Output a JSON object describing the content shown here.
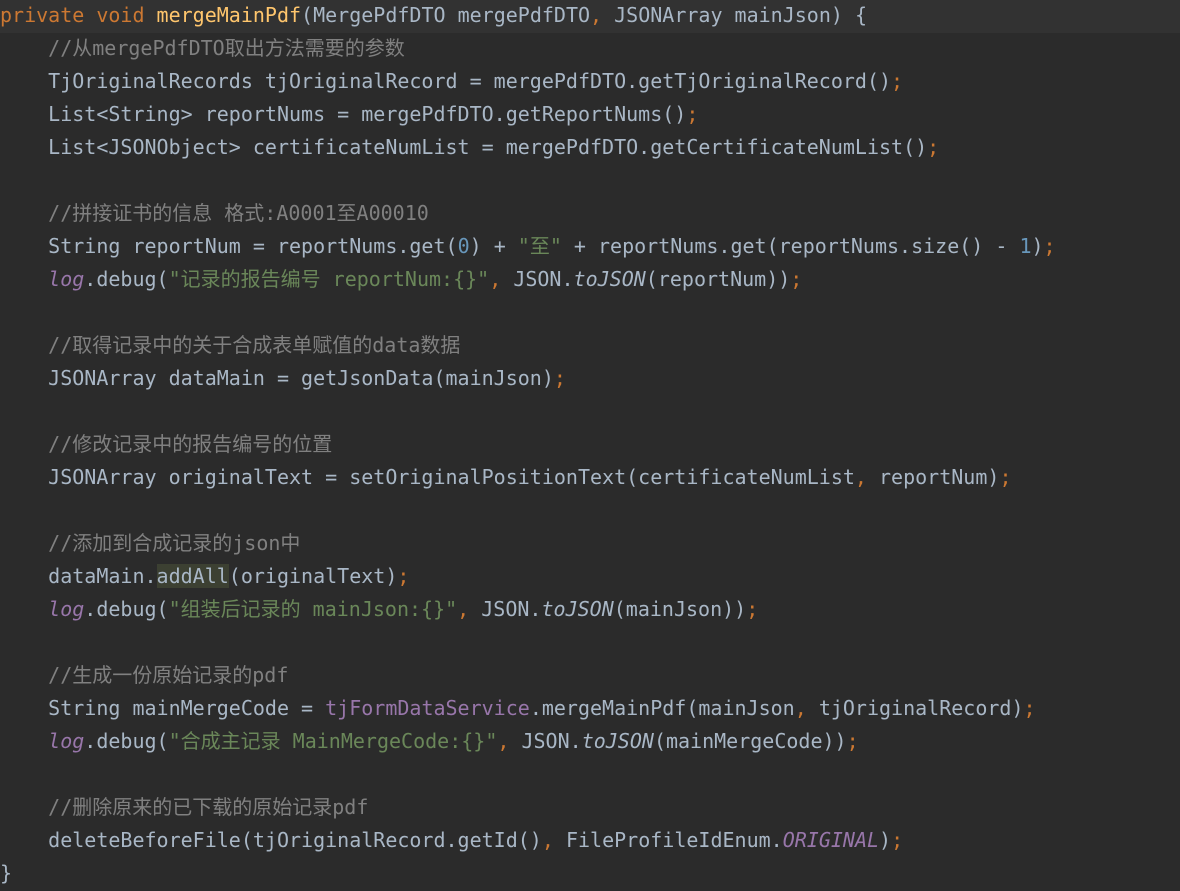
{
  "editor": {
    "caret_line": 0,
    "lines": [
      [
        [
          "kw",
          "private void "
        ],
        [
          "fn",
          "mergeMainPdf"
        ],
        [
          "pl",
          "(MergePdfDTO mergePdfDTO"
        ],
        [
          "pu",
          ", "
        ],
        [
          "pl",
          "JSONArray mainJson) {"
        ]
      ],
      [
        [
          "pl",
          "    "
        ],
        [
          "cm",
          "//从mergePdfDTO取出方法需要的参数"
        ]
      ],
      [
        [
          "pl",
          "    TjOriginalRecords tjOriginalRecord = mergePdfDTO.getTjOriginalRecord()"
        ],
        [
          "pu",
          ";"
        ]
      ],
      [
        [
          "pl",
          "    List<String> reportNums = mergePdfDTO.getReportNums()"
        ],
        [
          "pu",
          ";"
        ]
      ],
      [
        [
          "pl",
          "    List<JSONObject> certificateNumList = mergePdfDTO.getCertificateNumList()"
        ],
        [
          "pu",
          ";"
        ]
      ],
      [],
      [
        [
          "pl",
          "    "
        ],
        [
          "cm",
          "//拼接证书的信息 格式:A0001至A00010"
        ]
      ],
      [
        [
          "pl",
          "    String reportNum = reportNums.get("
        ],
        [
          "nu",
          "0"
        ],
        [
          "pl",
          ") + "
        ],
        [
          "st",
          "\"至\""
        ],
        [
          "pl",
          " + reportNums.get(reportNums.size() - "
        ],
        [
          "nu",
          "1"
        ],
        [
          "pl",
          ")"
        ],
        [
          "pu",
          ";"
        ]
      ],
      [
        [
          "pl",
          "    "
        ],
        [
          "lg",
          "log"
        ],
        [
          "pl",
          ".debug("
        ],
        [
          "st",
          "\"记录的报告编号 reportNum:{}\""
        ],
        [
          "pu",
          ", "
        ],
        [
          "pl",
          "JSON."
        ],
        [
          "it",
          "toJSON"
        ],
        [
          "pl",
          "(reportNum))"
        ],
        [
          "pu",
          ";"
        ]
      ],
      [],
      [
        [
          "pl",
          "    "
        ],
        [
          "cm",
          "//取得记录中的关于合成表单赋值的data数据"
        ]
      ],
      [
        [
          "pl",
          "    JSONArray dataMain = getJsonData(mainJson)"
        ],
        [
          "pu",
          ";"
        ]
      ],
      [],
      [
        [
          "pl",
          "    "
        ],
        [
          "cm",
          "//修改记录中的报告编号的位置"
        ]
      ],
      [
        [
          "pl",
          "    JSONArray originalText = setOriginalPositionText(certificateNumList"
        ],
        [
          "pu",
          ", "
        ],
        [
          "pl",
          "reportNum)"
        ],
        [
          "pu",
          ";"
        ]
      ],
      [],
      [
        [
          "pl",
          "    "
        ],
        [
          "cm",
          "//添加到合成记录的json中"
        ]
      ],
      [
        [
          "pl",
          "    dataMain."
        ],
        [
          "hl",
          "addAll"
        ],
        [
          "pl",
          "(originalText)"
        ],
        [
          "pu",
          ";"
        ]
      ],
      [
        [
          "pl",
          "    "
        ],
        [
          "lg",
          "log"
        ],
        [
          "pl",
          ".debug("
        ],
        [
          "st",
          "\"组装后记录的 mainJson:{}\""
        ],
        [
          "pu",
          ", "
        ],
        [
          "pl",
          "JSON."
        ],
        [
          "it",
          "toJSON"
        ],
        [
          "pl",
          "(mainJson))"
        ],
        [
          "pu",
          ";"
        ]
      ],
      [],
      [
        [
          "pl",
          "    "
        ],
        [
          "cm",
          "//生成一份原始记录的pdf"
        ]
      ],
      [
        [
          "pl",
          "    String mainMergeCode = "
        ],
        [
          "fd",
          "tjFormDataService"
        ],
        [
          "pl",
          ".mergeMainPdf(mainJson"
        ],
        [
          "pu",
          ", "
        ],
        [
          "pl",
          "tjOriginalRecord)"
        ],
        [
          "pu",
          ";"
        ]
      ],
      [
        [
          "pl",
          "    "
        ],
        [
          "lg",
          "log"
        ],
        [
          "pl",
          ".debug("
        ],
        [
          "st",
          "\"合成主记录 MainMergeCode:{}\""
        ],
        [
          "pu",
          ", "
        ],
        [
          "pl",
          "JSON."
        ],
        [
          "it",
          "toJSON"
        ],
        [
          "pl",
          "(mainMergeCode))"
        ],
        [
          "pu",
          ";"
        ]
      ],
      [],
      [
        [
          "pl",
          "    "
        ],
        [
          "cm",
          "//删除原来的已下载的原始记录pdf"
        ]
      ],
      [
        [
          "pl",
          "    deleteBeforeFile(tjOriginalRecord.getId()"
        ],
        [
          "pu",
          ", "
        ],
        [
          "pl",
          "FileProfileIdEnum."
        ],
        [
          "en",
          "ORIGINAL"
        ],
        [
          "pl",
          ")"
        ],
        [
          "pu",
          ";"
        ]
      ],
      [
        [
          "pl",
          "}"
        ]
      ]
    ]
  }
}
